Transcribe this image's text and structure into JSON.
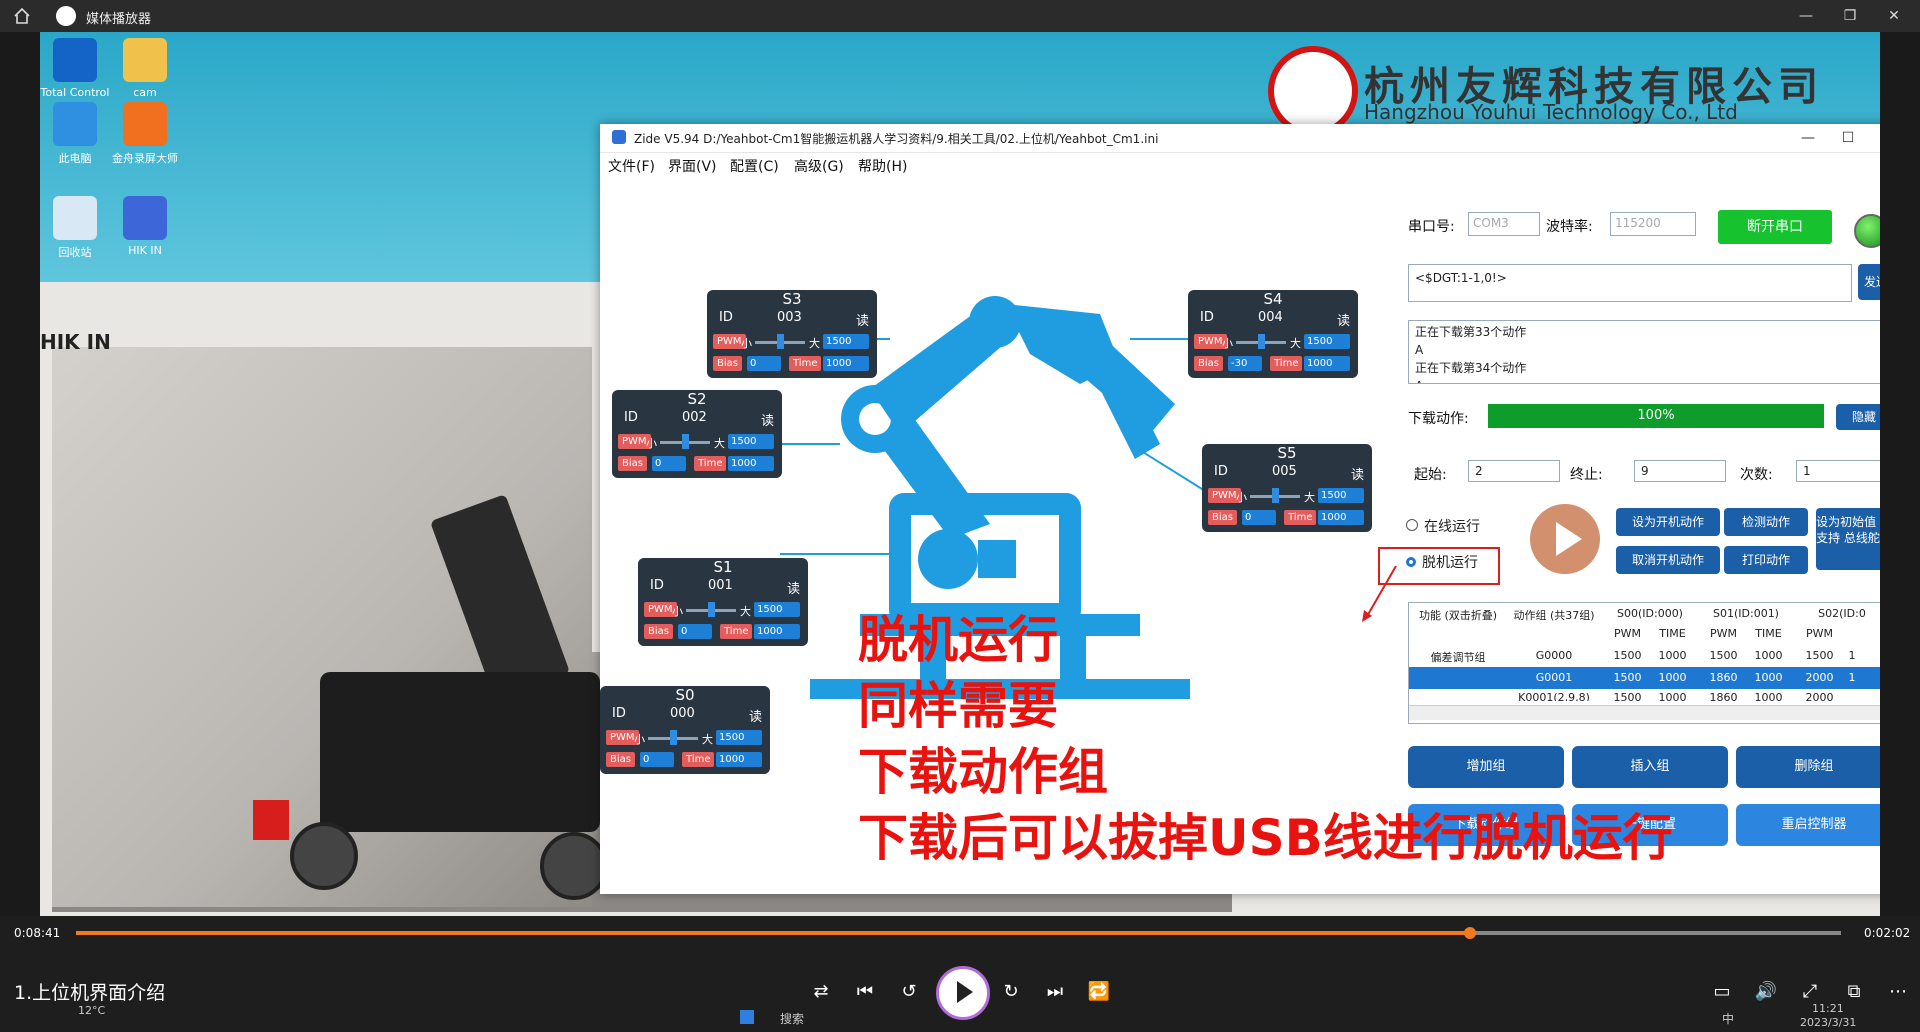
{
  "player": {
    "title": "媒体播放器",
    "video_title": "1.上位机界面介绍",
    "elapsed": "0:08:41",
    "remaining": "0:02:02",
    "progress_fraction": 0.79
  },
  "desktop": {
    "icons": [
      {
        "label": "Total Control"
      },
      {
        "label": "cam"
      },
      {
        "label": "此电脑"
      },
      {
        "label": "金舟录屏大师"
      },
      {
        "label": "回收站"
      },
      {
        "label": "HIK IN"
      }
    ],
    "heading": "HIK IN",
    "company_cn": "杭州友辉科技有限公司",
    "company_en": "Hangzhou Youhui Technology Co., Ltd",
    "taskbar_search": "搜索",
    "tray_time": "11:21",
    "tray_date": "2023/3/31",
    "tray_ime": "中",
    "weather": "12°C"
  },
  "zide": {
    "title": "Zide V5.94 D:/Yeahbot-Cm1智能搬运机器人学习资料/9.相关工具/02.上位机/Yeahbot_Cm1.ini",
    "menu": [
      "文件(F)",
      "界面(V)",
      "配置(C)",
      "高级(G)",
      "帮助(H)"
    ],
    "servo_labels": {
      "id": "ID",
      "read": "读",
      "pwm": "PWM",
      "small": "小",
      "big": "大",
      "bias": "Bias",
      "time": "Time"
    },
    "servos": [
      {
        "name": "S3",
        "id": "003",
        "pwm": "1500",
        "bias": "0",
        "time": "1000"
      },
      {
        "name": "S4",
        "id": "004",
        "pwm": "1500",
        "bias": "-30",
        "time": "1000"
      },
      {
        "name": "S2",
        "id": "002",
        "pwm": "1500",
        "bias": "0",
        "time": "1000"
      },
      {
        "name": "S5",
        "id": "005",
        "pwm": "1500",
        "bias": "0",
        "time": "1000"
      },
      {
        "name": "S1",
        "id": "001",
        "pwm": "1500",
        "bias": "0",
        "time": "1000"
      },
      {
        "name": "S0",
        "id": "000",
        "pwm": "1500",
        "bias": "0",
        "time": "1000"
      }
    ],
    "serial_label": "串口号:",
    "serial_value": "COM3",
    "baud_label": "波特率:",
    "baud_value": "115200",
    "disconnect_btn": "断开串口",
    "command_value": "<$DGT:1-1,0!>",
    "send_btn": "发送",
    "log_lines": [
      "正在下载第33个动作",
      "A",
      "正在下载第34个动作",
      "A"
    ],
    "download_label": "下载动作:",
    "download_percent": "100%",
    "hide_btn": "隐藏",
    "start_label": "起始:",
    "start_value": "2",
    "end_label": "终止:",
    "end_value": "9",
    "count_label": "次数:",
    "count_value": "1",
    "online_run": "在线运行",
    "offline_run": "脱机运行",
    "btn_set_boot": "设为开机动作",
    "btn_check": "检测动作",
    "btn_set_init": "设为初始值 仅支持 总线舵机",
    "btn_cancel_boot": "取消开机动作",
    "btn_print": "打印动作",
    "table": {
      "h_func": "功能 (双击折叠)",
      "h_group": "动作组 (共37组)",
      "h_s00": "S00(ID:000)",
      "h_s01": "S01(ID:001)",
      "h_s02": "S02(ID:0",
      "sub_pwm": "PWM",
      "sub_time": "TIME",
      "rows": [
        {
          "func": "偏差调节组",
          "group": "G0000",
          "c1": "1500",
          "c2": "1000",
          "c3": "1500",
          "c4": "1000",
          "c5": "1500",
          "c6": "1"
        },
        {
          "func": "",
          "group": "G0001",
          "c1": "1500",
          "c2": "1000",
          "c3": "1860",
          "c4": "1000",
          "c5": "2000",
          "c6": "1"
        },
        {
          "func": "",
          "group": "K0001(2,9,8)",
          "c1": "1500",
          "c2": "1000",
          "c3": "1860",
          "c4": "1000",
          "c5": "2000",
          "c6": ""
        }
      ]
    },
    "btn_add_group": "增加组",
    "btn_insert_group": "插入组",
    "btn_delete_group": "删除组",
    "btn_download_group": "下载动作组",
    "btn_one_key": "一键配置",
    "btn_restart": "重启控制器"
  },
  "caption": [
    "脱机运行",
    "同样需要",
    "下载动作组",
    "下载后可以拔掉USB线进行脱机运行"
  ]
}
